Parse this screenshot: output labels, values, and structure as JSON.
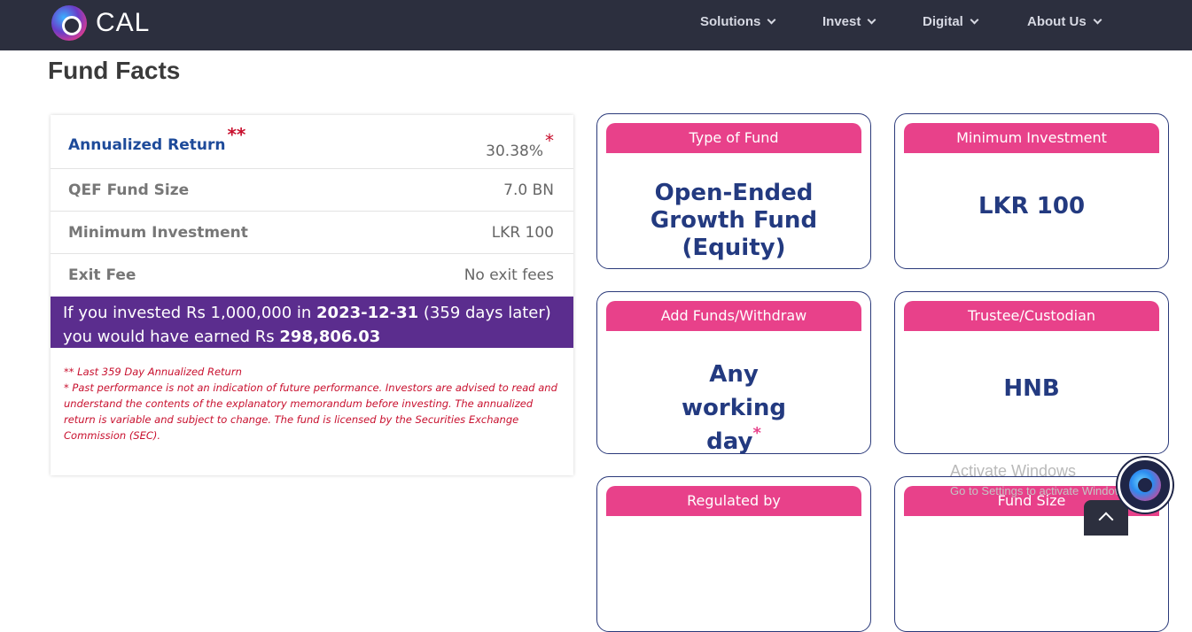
{
  "header": {
    "brand": "CAL",
    "nav": [
      "Solutions",
      "Invest",
      "Digital",
      "About Us"
    ]
  },
  "page": {
    "title": "Fund Facts"
  },
  "facts": {
    "rows": [
      {
        "label": "Annualized Return",
        "label_mark": "**",
        "value": "30.38%",
        "value_mark": "*"
      },
      {
        "label": "QEF Fund Size",
        "value": "7.0 BN"
      },
      {
        "label": "Minimum Investment",
        "value": "LKR 100"
      },
      {
        "label": "Exit Fee",
        "value": "No exit fees"
      }
    ],
    "banner": {
      "p1": "If you invested Rs 1,000,000 in ",
      "date": "2023-12-31",
      "p2": " (359 days later)",
      "p3": "you would have earned Rs ",
      "amount": "298,806.03"
    },
    "disclaimer": {
      "line1": "** Last 359 Day Annualized Return",
      "line2": "* Past performance is not an indication of future performance. Investors are advised to read and understand the contents of the explanatory memorandum before investing. The annualized return is variable and subject to change. The fund is licensed by the Securities Exchange Commission (SEC)."
    }
  },
  "tiles": [
    {
      "title": "Type of Fund",
      "value": "Open-Ended Growth Fund (Equity)"
    },
    {
      "title": "Minimum Investment",
      "value": "LKR 100"
    },
    {
      "title": "Add Funds/Withdraw",
      "value": "Any working day",
      "mark": "*"
    },
    {
      "title": "Trustee/Custodian",
      "value": "HNB"
    },
    {
      "title": "Regulated by",
      "value": ""
    },
    {
      "title": "Fund Size",
      "value": ""
    }
  ],
  "overlay": {
    "watermark_title": "Activate Windows",
    "watermark_sub": "Go to Settings to activate Windows."
  },
  "colors": {
    "navbar": "#2c2f3e",
    "accent_pink": "#e8418a",
    "banner_purple": "#5b2d8e",
    "value_navy": "#233a80"
  }
}
